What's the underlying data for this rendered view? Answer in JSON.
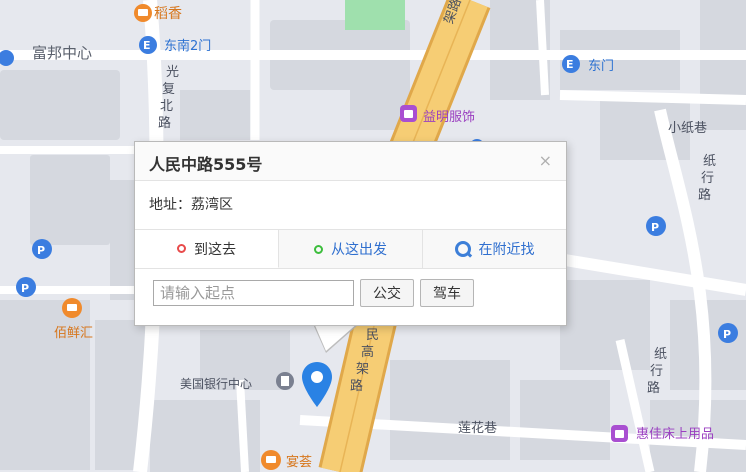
{
  "popup": {
    "title": "人民中路555号",
    "close_glyph": "×",
    "address_label": "地址：",
    "address_value": "荔湾区",
    "tabs": [
      {
        "label": "到这去",
        "icon": "red-ring-icon"
      },
      {
        "label": "从这出发",
        "icon": "green-ring-icon"
      },
      {
        "label": "在附近找",
        "icon": "search-icon"
      }
    ],
    "start_placeholder": "请输入起点",
    "start_value": "",
    "bus_button": "公交",
    "drive_button": "驾车"
  },
  "map": {
    "labels": {
      "daoxiang": "稻香",
      "dongnan2men": "东南2门",
      "fubang": "富邦中心",
      "guangfubeilu": [
        "光",
        "复",
        "北",
        "路"
      ],
      "dongmen": "东门",
      "yiming": "益明服饰",
      "xiaozhixiang": "小纸巷",
      "zhixinglu_top": [
        "纸",
        "行",
        "路"
      ],
      "zhixinglu_bottom": [
        "纸",
        "行",
        "路"
      ],
      "baixianhui": "佰鲜汇",
      "meiguoyinhang": "美国银行中心",
      "renmingaojialu_top": "架路",
      "renmingaojialu_mid": [
        "民",
        "高",
        "架",
        "路"
      ],
      "lianhuaxiang": "莲花巷",
      "huijia": "惠佳床上用品",
      "yanhui": "宴荟"
    },
    "colors": {
      "road_major": "#f5c969",
      "road_major_edge": "#e0a84a",
      "road_minor": "#ffffff",
      "block": "#d8dbe2",
      "green": "#9ee3a8",
      "marker": "#2a82e4"
    }
  }
}
